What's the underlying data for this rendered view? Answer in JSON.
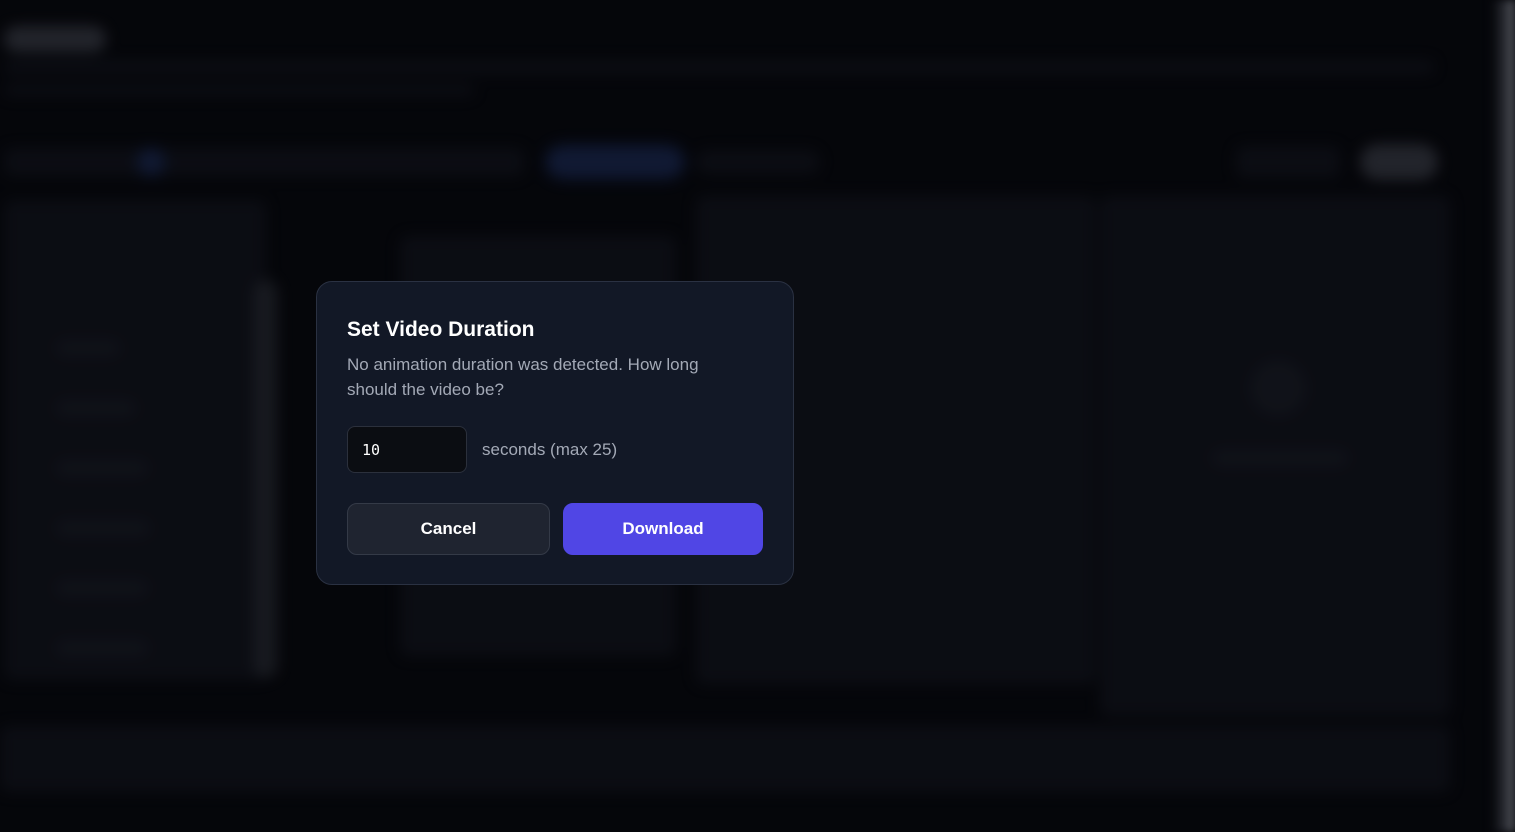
{
  "dialog": {
    "title": "Set Video Duration",
    "description": "No animation duration was detected. How long should the video be?",
    "duration_value": "10",
    "duration_unit_label": "seconds (max 25)",
    "cancel_label": "Cancel",
    "download_label": "Download"
  },
  "colors": {
    "primary": "#5046e5",
    "modal_background": "#121826",
    "page_background": "#05060a"
  }
}
